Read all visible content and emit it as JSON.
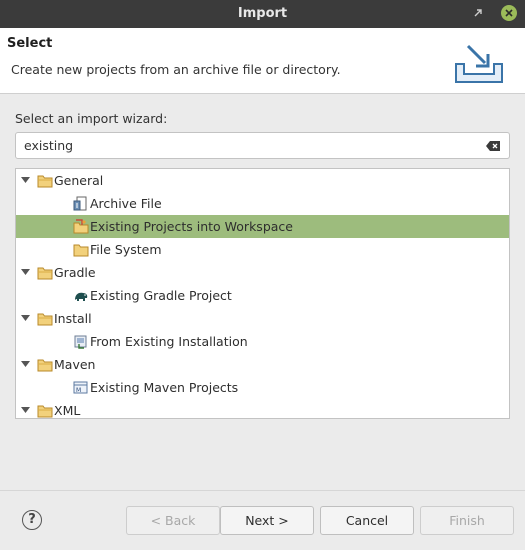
{
  "window": {
    "title": "Import"
  },
  "header": {
    "title": "Select",
    "description": "Create new projects from an archive file or directory."
  },
  "wizard": {
    "prompt": "Select an import wizard:",
    "filter_value": "existing",
    "tree": [
      {
        "label": "General",
        "type": "folder",
        "expanded": true
      },
      {
        "label": "Archive File",
        "type": "item",
        "icon": "archive-file-icon"
      },
      {
        "label": "Existing Projects into Workspace",
        "type": "item",
        "icon": "existing-projects-icon",
        "selected": true
      },
      {
        "label": "File System",
        "type": "item",
        "icon": "folder-icon"
      },
      {
        "label": "Gradle",
        "type": "folder",
        "expanded": true
      },
      {
        "label": "Existing Gradle Project",
        "type": "item",
        "icon": "gradle-elephant-icon"
      },
      {
        "label": "Install",
        "type": "folder",
        "expanded": true
      },
      {
        "label": "From Existing Installation",
        "type": "item",
        "icon": "installation-icon"
      },
      {
        "label": "Maven",
        "type": "folder",
        "expanded": true
      },
      {
        "label": "Existing Maven Projects",
        "type": "item",
        "icon": "maven-project-icon"
      },
      {
        "label": "XML",
        "type": "folder",
        "expanded": true
      }
    ]
  },
  "footer": {
    "back_label": "< Back",
    "next_label": "Next >",
    "cancel_label": "Cancel",
    "finish_label": "Finish"
  },
  "colors": {
    "selection": "#9dbc7d",
    "titlebar": "#3b3b3b",
    "close": "#9bbb59"
  }
}
